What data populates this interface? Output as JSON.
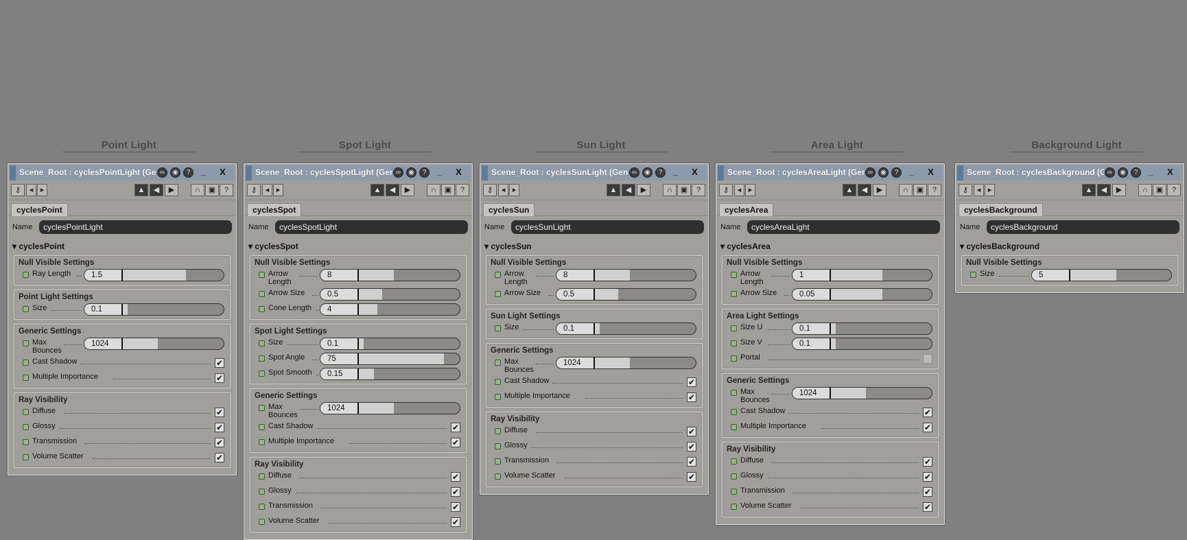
{
  "colors": {
    "background": "#808080",
    "panel": "#a19f9b",
    "light_glyph": "#e8400f",
    "title_bar": "#8d9aab"
  },
  "icons": {
    "titlebar": [
      "link-icon",
      "sphere-icon",
      "help-circle-icon"
    ],
    "toolbar_left": [
      "key-icon",
      "arrow-left-icon",
      "arrow-right-icon"
    ],
    "toolbar_right": [
      "arrow-up-icon",
      "rewind-icon",
      "forward-icon",
      "magnet-icon",
      "cube-icon",
      "question-icon"
    ]
  },
  "window_buttons": {
    "minimize": "_",
    "close": "X"
  },
  "columns": [
    {
      "label": "Point Light",
      "panel": {
        "title": "Scene_Root : cyclesPointLight (Ge...",
        "tab": "cyclesPoint",
        "name_label": "Name",
        "name_value": "cyclesPointLight",
        "section": "cyclesPoint",
        "groups": [
          {
            "title": "Null Visible Settings",
            "params": [
              {
                "label": "Ray Length",
                "type": "slider",
                "value": "1.5",
                "fill": 0.62
              }
            ]
          },
          {
            "title": "Point Light Settings",
            "params": [
              {
                "label": "Size",
                "type": "slider",
                "value": "0.1",
                "fill": 0.05
              }
            ]
          },
          {
            "title": "Generic Settings",
            "params": [
              {
                "label": "Max Bounces",
                "type": "slider",
                "value": "1024",
                "fill": 0.34
              },
              {
                "label": "Cast Shadow",
                "type": "check",
                "checked": true
              },
              {
                "label": "Multiple Importance",
                "type": "check",
                "checked": true
              }
            ]
          },
          {
            "title": "Ray Visibility",
            "params": [
              {
                "label": "Diffuse",
                "type": "check",
                "checked": true
              },
              {
                "label": "Glossy",
                "type": "check",
                "checked": true
              },
              {
                "label": "Transmission",
                "type": "check",
                "checked": true
              },
              {
                "label": "Volume Scatter",
                "type": "check",
                "checked": true
              }
            ]
          }
        ]
      }
    },
    {
      "label": "Spot Light",
      "panel": {
        "title": "Scene_Root : cyclesSpotLight (Gen...",
        "tab": "cyclesSpot",
        "name_label": "Name",
        "name_value": "cyclesSpotLight",
        "section": "cyclesSpot",
        "groups": [
          {
            "title": "Null Visible Settings",
            "params": [
              {
                "label": "Arrow Length",
                "type": "slider",
                "value": "8",
                "fill": 0.34
              },
              {
                "label": "Arrow Size",
                "type": "slider",
                "value": "0.5",
                "fill": 0.23
              },
              {
                "label": "Cone Length",
                "type": "slider",
                "value": "4",
                "fill": 0.18
              }
            ]
          },
          {
            "title": "Spot Light Settings",
            "params": [
              {
                "label": "Size",
                "type": "slider",
                "value": "0.1",
                "fill": 0.05
              },
              {
                "label": "Spot Angle",
                "type": "slider",
                "value": "75",
                "fill": 0.83
              },
              {
                "label": "Spot Smooth",
                "type": "slider",
                "value": "0.15",
                "fill": 0.15
              }
            ]
          },
          {
            "title": "Generic Settings",
            "params": [
              {
                "label": "Max Bounces",
                "type": "slider",
                "value": "1024",
                "fill": 0.34
              },
              {
                "label": "Cast Shadow",
                "type": "check",
                "checked": true
              },
              {
                "label": "Multiple Importance",
                "type": "check",
                "checked": true
              }
            ]
          },
          {
            "title": "Ray Visibility",
            "params": [
              {
                "label": "Diffuse",
                "type": "check",
                "checked": true
              },
              {
                "label": "Glossy",
                "type": "check",
                "checked": true
              },
              {
                "label": "Transmission",
                "type": "check",
                "checked": true
              },
              {
                "label": "Volume Scatter",
                "type": "check",
                "checked": true
              }
            ]
          }
        ]
      }
    },
    {
      "label": "Sun Light",
      "panel": {
        "title": "Scene_Root : cyclesSunLight (Gen...",
        "tab": "cyclesSun",
        "name_label": "Name",
        "name_value": "cyclesSunLight",
        "section": "cyclesSun",
        "groups": [
          {
            "title": "Null Visible Settings",
            "params": [
              {
                "label": "Arrow Length",
                "type": "slider",
                "value": "8",
                "fill": 0.34
              },
              {
                "label": "Arrow Size",
                "type": "slider",
                "value": "0.5",
                "fill": 0.23
              }
            ]
          },
          {
            "title": "Sun Light Settings",
            "params": [
              {
                "label": "Size",
                "type": "slider",
                "value": "0.1",
                "fill": 0.05
              }
            ]
          },
          {
            "title": "Generic Settings",
            "params": [
              {
                "label": "Max Bounces",
                "type": "slider",
                "value": "1024",
                "fill": 0.34
              },
              {
                "label": "Cast Shadow",
                "type": "check",
                "checked": true
              },
              {
                "label": "Multiple Importance",
                "type": "check",
                "checked": true
              }
            ]
          },
          {
            "title": "Ray Visibility",
            "params": [
              {
                "label": "Diffuse",
                "type": "check",
                "checked": true
              },
              {
                "label": "Glossy",
                "type": "check",
                "checked": true
              },
              {
                "label": "Transmission",
                "type": "check",
                "checked": true
              },
              {
                "label": "Volume Scatter",
                "type": "check",
                "checked": true
              }
            ]
          }
        ]
      }
    },
    {
      "label": "Area Light",
      "panel": {
        "title": "Scene_Root : cyclesAreaLight (Gen...",
        "tab": "cyclesArea",
        "name_label": "Name",
        "name_value": "cyclesAreaLight",
        "section": "cyclesArea",
        "groups": [
          {
            "title": "Null Visible Settings",
            "params": [
              {
                "label": "Arrow Length",
                "type": "slider",
                "value": "1",
                "fill": 0.5
              },
              {
                "label": "Arrow Size",
                "type": "slider",
                "value": "0.05",
                "fill": 0.5
              }
            ]
          },
          {
            "title": "Area Light Settings",
            "params": [
              {
                "label": "Size U",
                "type": "slider",
                "value": "0.1",
                "fill": 0.05
              },
              {
                "label": "Size V",
                "type": "slider",
                "value": "0.1",
                "fill": 0.05
              },
              {
                "label": "Portal",
                "type": "check",
                "checked": false
              }
            ]
          },
          {
            "title": "Generic Settings",
            "params": [
              {
                "label": "Max Bounces",
                "type": "slider",
                "value": "1024",
                "fill": 0.34
              },
              {
                "label": "Cast Shadow",
                "type": "check",
                "checked": true
              },
              {
                "label": "Multiple Importance",
                "type": "check",
                "checked": true
              }
            ]
          },
          {
            "title": "Ray Visibility",
            "params": [
              {
                "label": "Diffuse",
                "type": "check",
                "checked": true
              },
              {
                "label": "Glossy",
                "type": "check",
                "checked": true
              },
              {
                "label": "Transmission",
                "type": "check",
                "checked": true
              },
              {
                "label": "Volume Scatter",
                "type": "check",
                "checked": true
              }
            ]
          }
        ]
      }
    },
    {
      "label": "Background Light",
      "panel": {
        "title": "Scene_Root : cyclesBackground (G...",
        "tab": "cyclesBackground",
        "name_label": "Name",
        "name_value": "cyclesBackground",
        "section": "cyclesBackground",
        "groups": [
          {
            "title": "Null Visible Settings",
            "params": [
              {
                "label": "Size",
                "type": "slider",
                "value": "5",
                "fill": 0.45
              }
            ]
          }
        ]
      }
    }
  ]
}
